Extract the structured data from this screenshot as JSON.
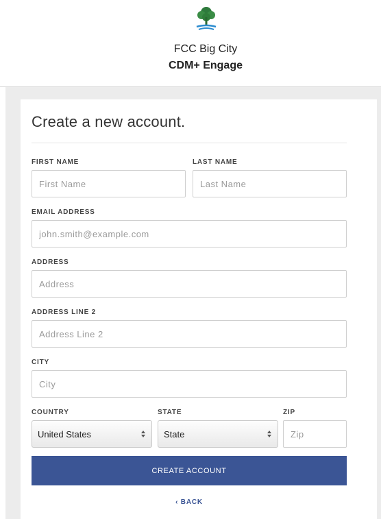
{
  "header": {
    "org_name": "FCC Big City",
    "app_name": "CDM+ Engage"
  },
  "form": {
    "title": "Create a new account.",
    "first_name": {
      "label": "FIRST NAME",
      "placeholder": "First Name"
    },
    "last_name": {
      "label": "LAST NAME",
      "placeholder": "Last Name"
    },
    "email": {
      "label": "EMAIL ADDRESS",
      "placeholder": "john.smith@example.com"
    },
    "address": {
      "label": "ADDRESS",
      "placeholder": "Address"
    },
    "address2": {
      "label": "ADDRESS LINE 2",
      "placeholder": "Address Line 2"
    },
    "city": {
      "label": "CITY",
      "placeholder": "City"
    },
    "country": {
      "label": "COUNTRY",
      "value": "United States"
    },
    "state": {
      "label": "STATE",
      "value": "State"
    },
    "zip": {
      "label": "ZIP",
      "placeholder": "Zip"
    },
    "submit_label": "CREATE ACCOUNT",
    "back_label": "‹ BACK"
  },
  "colors": {
    "accent": "#3b5595",
    "background": "#ececec"
  },
  "icons": {
    "logo": "tree-logo-icon",
    "select_arrows": "updown-arrows-icon"
  }
}
